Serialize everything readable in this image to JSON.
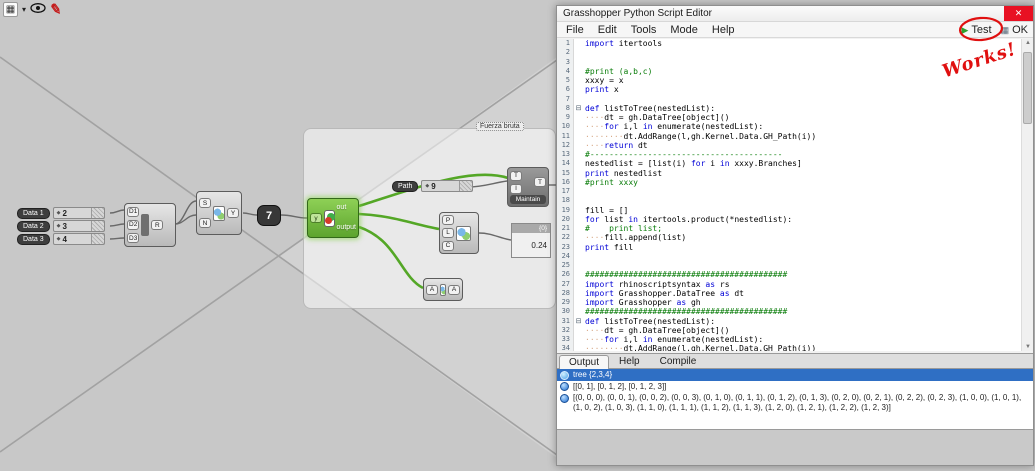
{
  "toolbar": {
    "icons": [
      "canvas-grid-icon",
      "dropdown-arrow-icon",
      "eye-icon",
      "red-pen-icon"
    ]
  },
  "canvas": {
    "group_label": "Fuerza bruta",
    "panels": [
      {
        "label": "Data 1",
        "value": "2"
      },
      {
        "label": "Data 2",
        "value": "3"
      },
      {
        "label": "Data 3",
        "value": "4"
      }
    ],
    "merge": {
      "ports_in": [
        "D1",
        "D2",
        "D3"
      ],
      "port_out": "R"
    },
    "entwine": {
      "ports_in": [
        "S",
        "N"
      ],
      "port_out": "Y"
    },
    "number": "7",
    "python": {
      "port_in": "y",
      "ports_out": [
        "out",
        "output"
      ]
    },
    "path_panel": {
      "label": "Path",
      "value": "9"
    },
    "maintain": {
      "label": "Maintain",
      "ports_in": [
        "T",
        "I"
      ],
      "port_out": "T"
    },
    "plc": {
      "ports_in": [
        "P",
        "L",
        "C"
      ]
    },
    "result_panel": {
      "header": "{0}",
      "value": "0.24"
    },
    "aa": {
      "port_in": "A",
      "port_out": "A"
    }
  },
  "editor": {
    "title": "Grasshopper Python Script Editor",
    "menu": [
      "File",
      "Edit",
      "Tools",
      "Mode",
      "Help"
    ],
    "test_label": "Test",
    "ok_label": "OK",
    "annotation": "Works!",
    "tabs": [
      "Output",
      "Help",
      "Compile"
    ],
    "code": [
      "import itertools",
      "",
      "",
      "#print (a,b,c)",
      "xxxy = x",
      "print x",
      "",
      "def listToTree(nestedList):",
      "    dt = gh.DataTree[object]()",
      "    for i,l in enumerate(nestedList):",
      "        dt.AddRange(l,gh.Kernel.Data.GH_Path(i))",
      "    return dt",
      "#----------------------------------------",
      "nestedlist = [list(i) for i in xxxy.Branches]",
      "print nestedlist",
      "#print xxxy",
      "",
      "",
      "fill = []",
      "for list in itertools.product(*nestedlist):",
      "#    print list;",
      "    fill.append(list)",
      "print fill",
      "",
      "",
      "##########################################",
      "import rhinoscriptsyntax as rs",
      "import Grasshopper.DataTree as dt",
      "import Grasshopper as gh",
      "##########################################",
      "def listToTree(nestedList):",
      "    dt = gh.DataTree[object]()",
      "    for i,l in enumerate(nestedList):",
      "        dt.AddRange(l,gh.Kernel.Data.GH_Path(i))"
    ],
    "output_rows": [
      {
        "icon": "tree-icon",
        "selected": true,
        "text": "tree {2,3,4}"
      },
      {
        "icon": "globe-icon",
        "selected": false,
        "text": "[[0, 1], [0, 1, 2], [0, 1, 2, 3]]"
      },
      {
        "icon": "globe-icon",
        "selected": false,
        "text": "[(0, 0, 0), (0, 0, 1), (0, 0, 2), (0, 0, 3), (0, 1, 0), (0, 1, 1), (0, 1, 2), (0, 1, 3), (0, 2, 0), (0, 2, 1), (0, 2, 2), (0, 2, 3), (1, 0, 0), (1, 0, 1), (1, 0, 2), (1, 0, 3), (1, 1, 0), (1, 1, 1), (1, 1, 2), (1, 1, 3), (1, 2, 0), (1, 2, 1), (1, 2, 2), (1, 2, 3)]"
      }
    ]
  }
}
